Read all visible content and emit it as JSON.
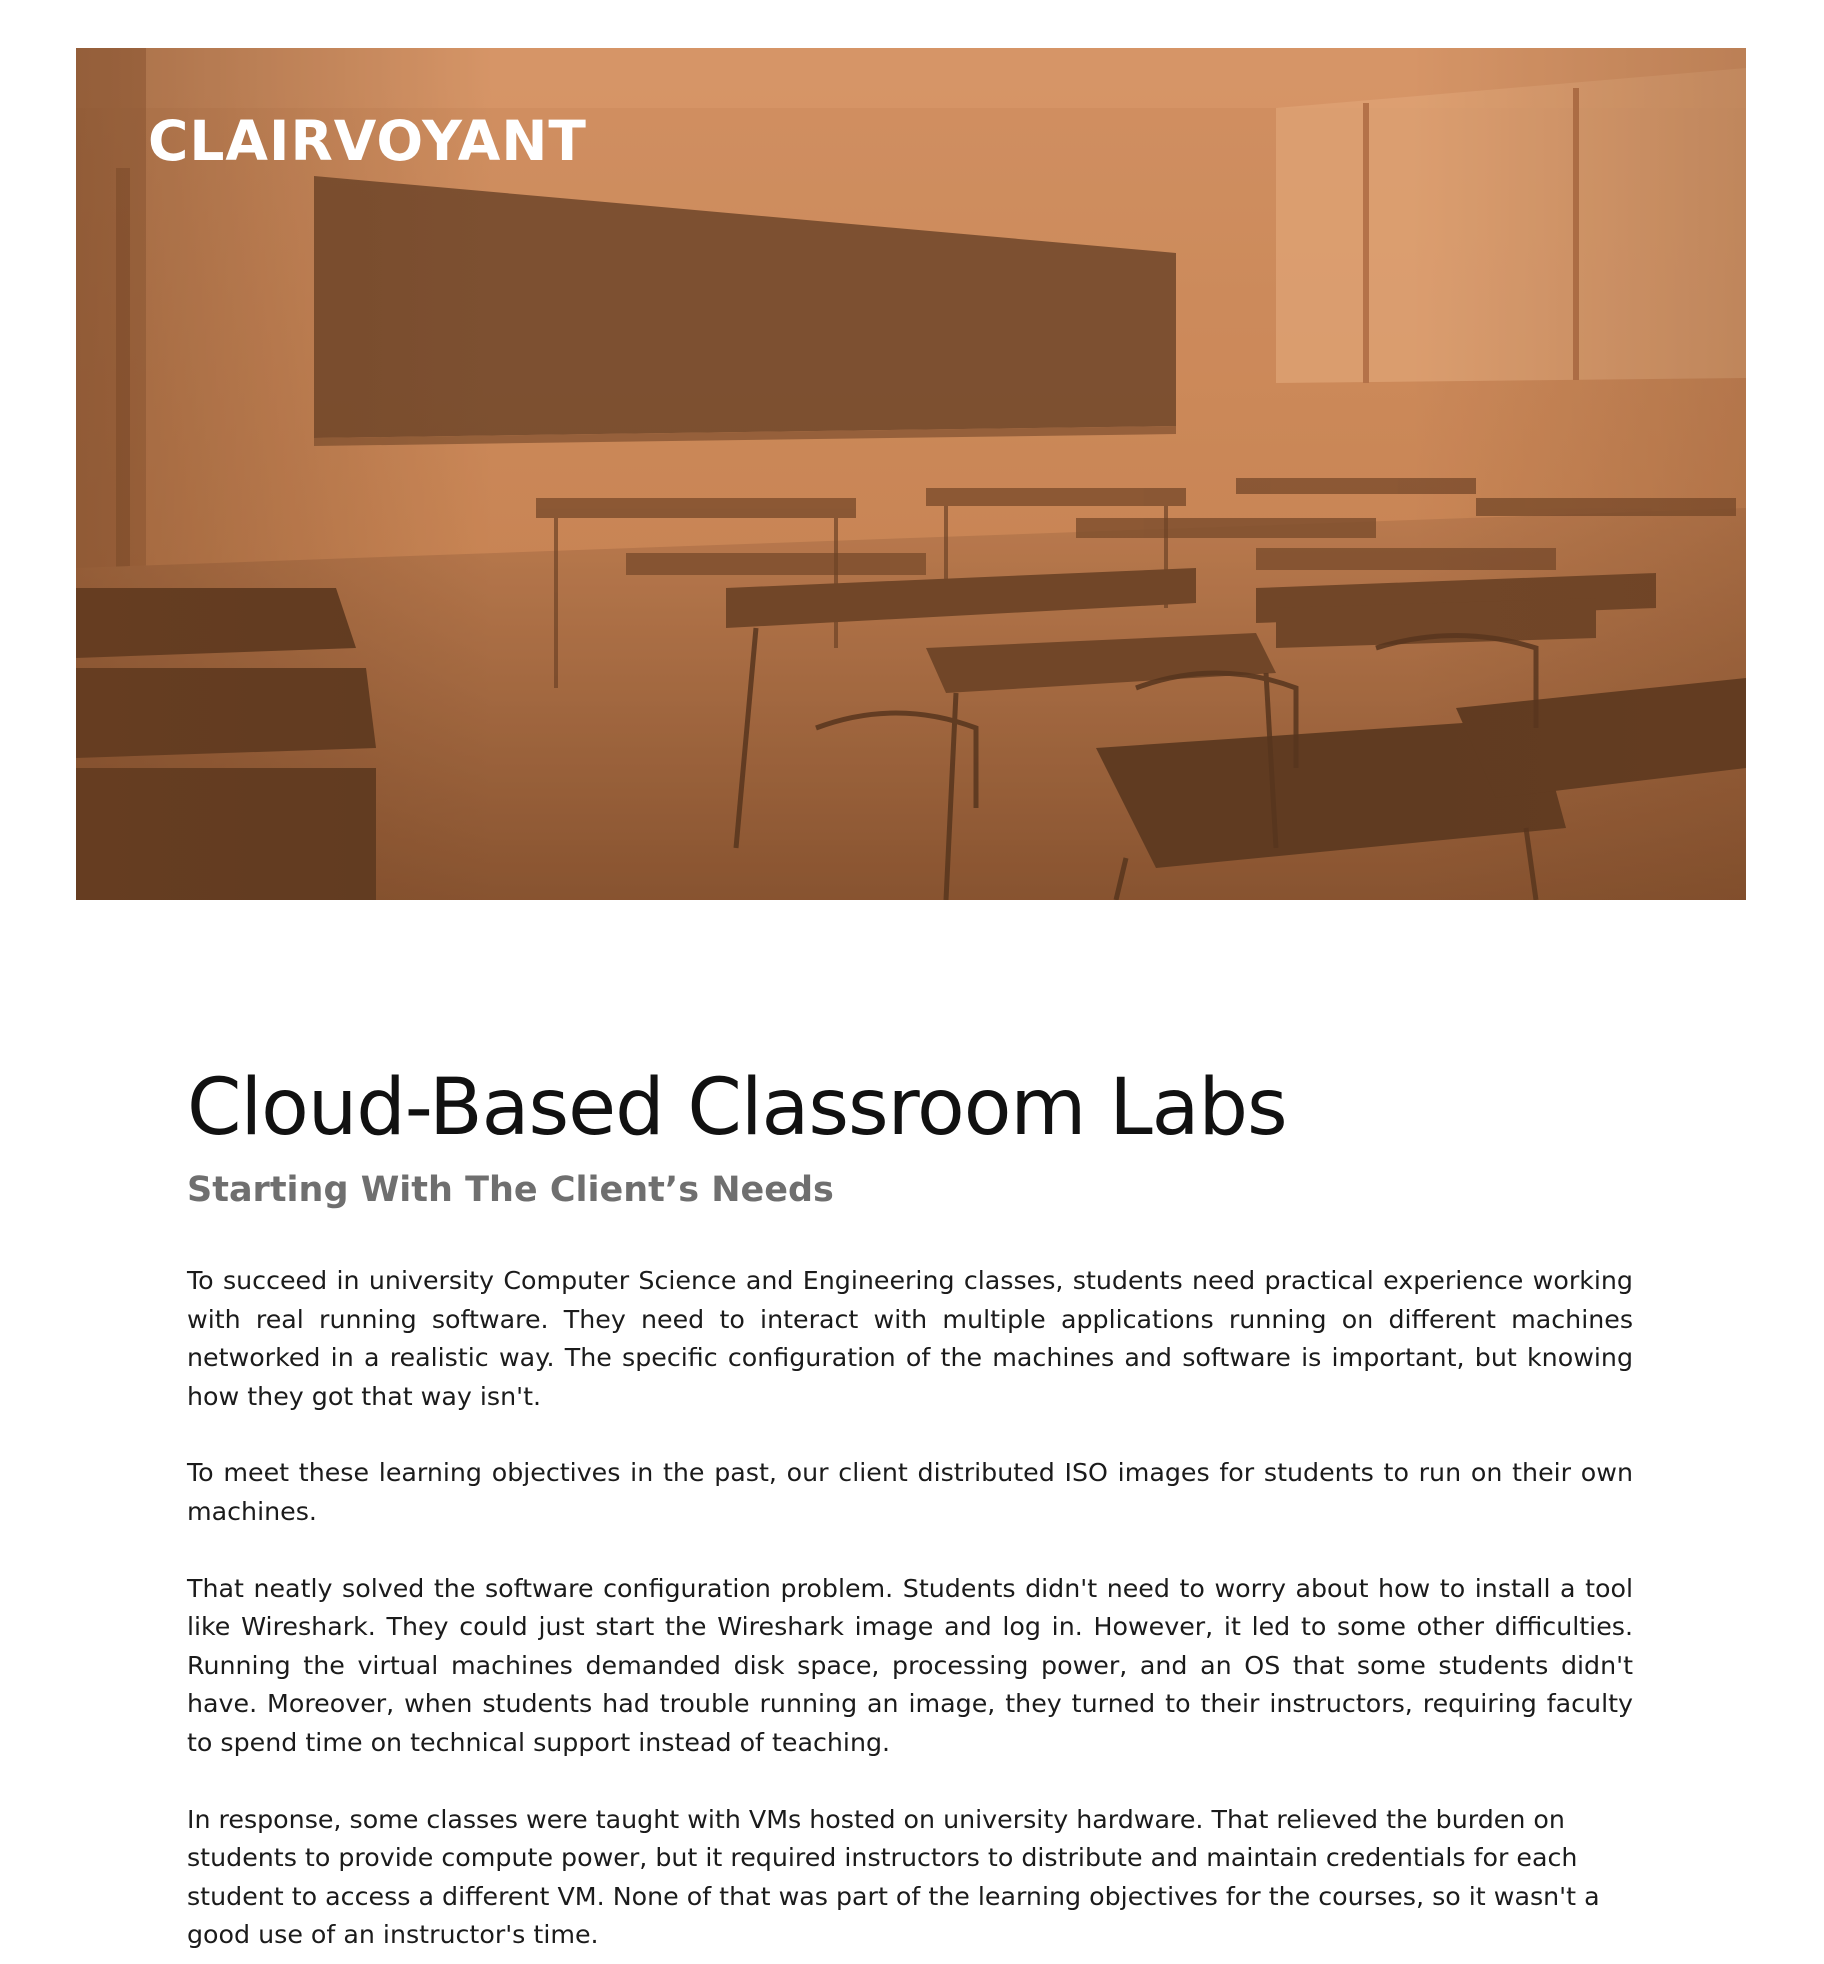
{
  "hero": {
    "logo_text": "CLAIRVOYANT",
    "image_description": "classroom-desks-photo",
    "tint_color": "#c8804f"
  },
  "article": {
    "title": "Cloud-Based Classroom Labs",
    "subtitle": "Starting With The Client’s Needs",
    "paragraphs": [
      "To succeed in university Computer Science and Engineering classes, students need practical experience working with real running software. They need to interact with multiple applications running on different machines networked in a realistic way. The specific configuration of the machines and software is important, but knowing how they got that way isn't.",
      "To meet these learning objectives in the past, our client distributed ISO images for students to run on their own machines.",
      "That neatly solved the software configuration problem. Students didn't need to worry about how to install a tool like Wireshark. They could just start the Wireshark image and log in. However, it led to some other difficulties. Running the virtual machines demanded disk space, processing power, and an OS that some students didn't have. Moreover, when students had trouble running an image, they turned to their instructors, requiring faculty to spend time on technical support instead of teaching.",
      "In response, some classes were taught with VMs hosted on university hardware. That relieved the burden on students to provide compute power, but it required instructors to distribute and maintain credentials for each student to access a different VM. None of that was part of the learning objectives for the courses, so it wasn't a good use of an instructor's time."
    ]
  },
  "colors": {
    "title": "#111111",
    "subtitle": "#6f6f6f",
    "body": "#1b1b1b"
  }
}
